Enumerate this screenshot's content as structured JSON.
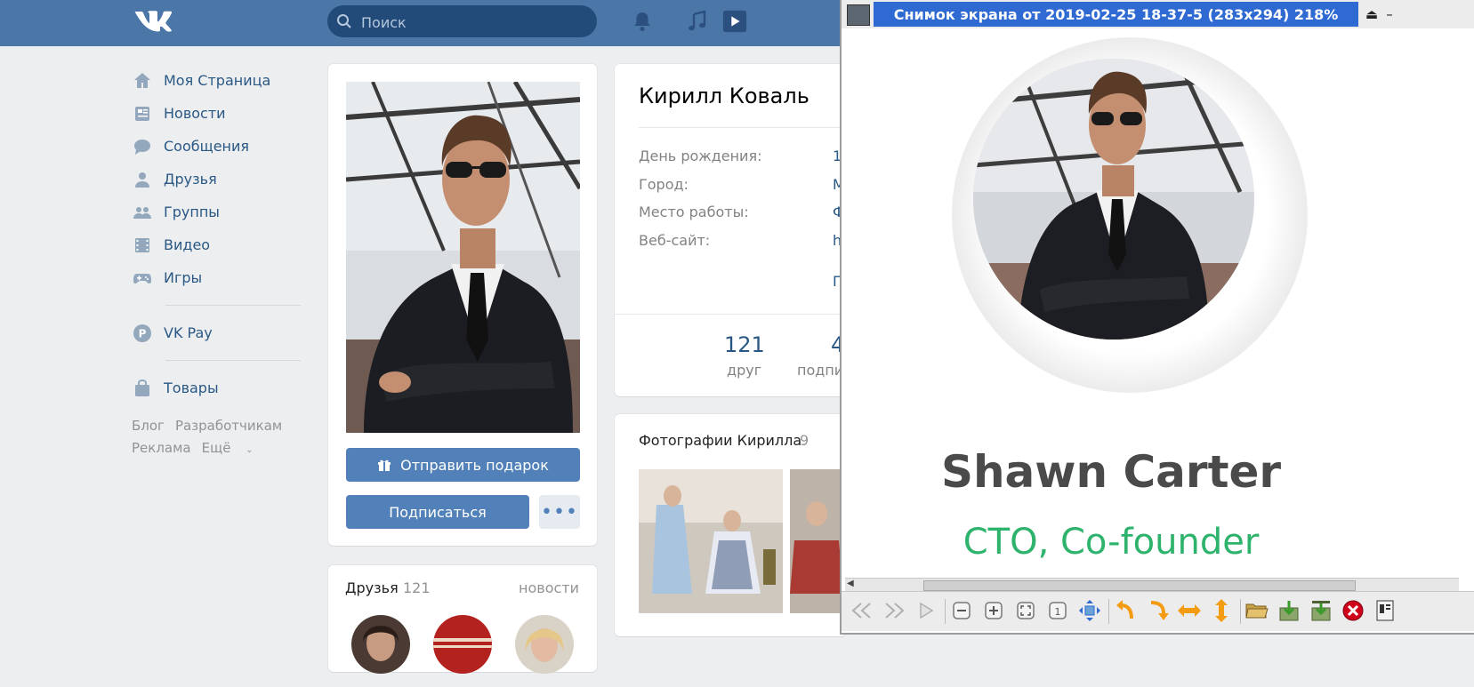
{
  "topbar": {
    "search_placeholder": "Поиск"
  },
  "leftnav": {
    "items": [
      {
        "label": "Моя Страница",
        "icon": "home-icon"
      },
      {
        "label": "Новости",
        "icon": "news-icon"
      },
      {
        "label": "Сообщения",
        "icon": "messages-icon"
      },
      {
        "label": "Друзья",
        "icon": "friend-icon"
      },
      {
        "label": "Группы",
        "icon": "groups-icon"
      },
      {
        "label": "Видео",
        "icon": "video-icon"
      },
      {
        "label": "Игры",
        "icon": "gamepad-icon"
      }
    ],
    "vkpay": {
      "label": "VK Pay",
      "icon": "vkpay-icon"
    },
    "goods": {
      "label": "Товары",
      "icon": "bag-icon"
    },
    "footer": {
      "blog": "Блог",
      "dev": "Разработчикам",
      "ads": "Реклама",
      "more": "Ещё"
    }
  },
  "profile": {
    "gift_button": "Отправить подарок",
    "subscribe_button": "Подписаться",
    "more_button": "•••"
  },
  "friends": {
    "title": "Друзья",
    "count": "121",
    "news_link": "новости"
  },
  "info": {
    "name": "Кирилл Коваль",
    "rows": [
      {
        "label": "День рождения:",
        "value": "1"
      },
      {
        "label": "Город:",
        "value": "М"
      },
      {
        "label": "Место работы:",
        "value": "Ф"
      },
      {
        "label": "Веб-сайт:",
        "value": "h"
      }
    ],
    "more_value": "П",
    "stats": [
      {
        "num": "121",
        "label": "друг"
      },
      {
        "num": "4",
        "label": "подпи"
      }
    ]
  },
  "photos": {
    "title": "Фотографии Кирилла",
    "count": "9"
  },
  "viewer": {
    "title": "Снимок экрана от 2019-02-25 18-37-5 (283x294) 218%",
    "person_name": "Shawn Carter",
    "person_role": "CTO, Co-founder",
    "colors": {
      "titlebar": "#2e6ad2",
      "role": "#2db36b"
    }
  }
}
